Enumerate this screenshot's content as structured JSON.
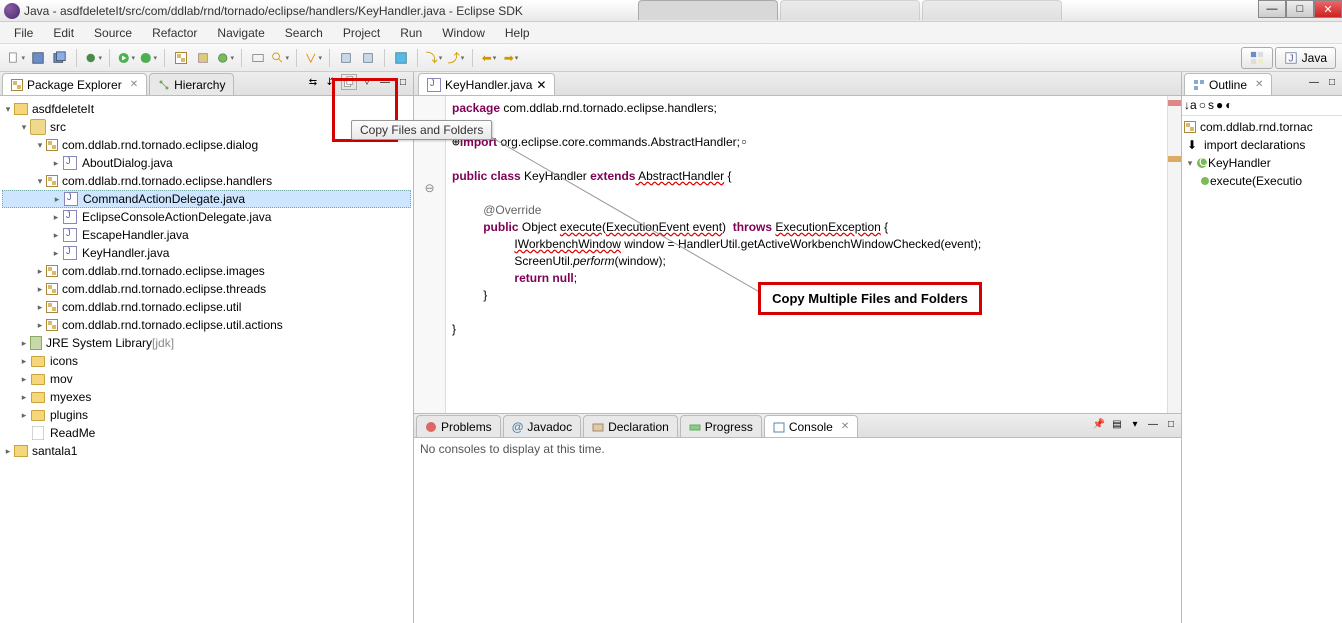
{
  "window": {
    "title": "Java - asdfdeleteIt/src/com/ddlab/rnd/tornado/eclipse/handlers/KeyHandler.java - Eclipse SDK"
  },
  "menu": [
    "File",
    "Edit",
    "Source",
    "Refactor",
    "Navigate",
    "Search",
    "Project",
    "Run",
    "Window",
    "Help"
  ],
  "perspective": {
    "label": "Java"
  },
  "views": {
    "pkg_explorer": "Package Explorer",
    "hierarchy": "Hierarchy",
    "outline": "Outline"
  },
  "tooltip": "Copy Files and Folders",
  "annotation": "Copy Multiple Files and Folders",
  "tree": {
    "p0": "asdfdeleteIt",
    "p1": "src",
    "p2": "com.ddlab.rnd.tornado.eclipse.dialog",
    "p2a": "AboutDialog.java",
    "p3": "com.ddlab.rnd.tornado.eclipse.handlers",
    "p3a": "CommandActionDelegate.java",
    "p3b": "EclipseConsoleActionDelegate.java",
    "p3c": "EscapeHandler.java",
    "p3d": "KeyHandler.java",
    "p4": "com.ddlab.rnd.tornado.eclipse.images",
    "p5": "com.ddlab.rnd.tornado.eclipse.threads",
    "p6": "com.ddlab.rnd.tornado.eclipse.util",
    "p7": "com.ddlab.rnd.tornado.eclipse.util.actions",
    "p8": "JRE System Library",
    "p8suf": "[jdk]",
    "p9": "icons",
    "p10": "mov",
    "p11": "myexes",
    "p12": "plugins",
    "p13": "ReadMe",
    "q0": "santala1"
  },
  "editor": {
    "filename": "KeyHandler.java",
    "code": {
      "l1a": "package",
      "l1b": " com.ddlab.rnd.tornado.eclipse.handlers;",
      "l2a": "import",
      "l2b": " org.eclipse.core.commands.AbstractHandler;",
      "l3a": "public",
      "l3b": " class",
      "l3c": " KeyHandler ",
      "l3d": "extends",
      "l3e": " AbstractHandler",
      "l3f": " {",
      "l4": "@Override",
      "l5a": "public",
      "l5b": " Object ",
      "l5c": "execute",
      "l5d": "(",
      "l5e": "ExecutionEvent",
      "l5f": " event",
      "l5g": ")  ",
      "l5h": "throws",
      "l5i": " ",
      "l5j": "ExecutionException",
      "l5k": " {",
      "l6a": "IWorkbenchWindow",
      "l6b": " window = HandlerUtil.getActiveWorkbenchWindowChecked(event);",
      "l7a": "ScreenUtil.",
      "l7b": "perform",
      "l7c": "(window);",
      "l8a": "return",
      "l8b": " null",
      "l8c": ";",
      "l9": "}",
      "l10": "}"
    }
  },
  "bottom": {
    "tabs": [
      "Problems",
      "Javadoc",
      "Declaration",
      "Progress",
      "Console"
    ],
    "empty": "No consoles to display at this time."
  },
  "outline": {
    "i0": "com.ddlab.rnd.tornac",
    "i1": "import declarations",
    "i2": "KeyHandler",
    "i3": "execute(Executio"
  }
}
